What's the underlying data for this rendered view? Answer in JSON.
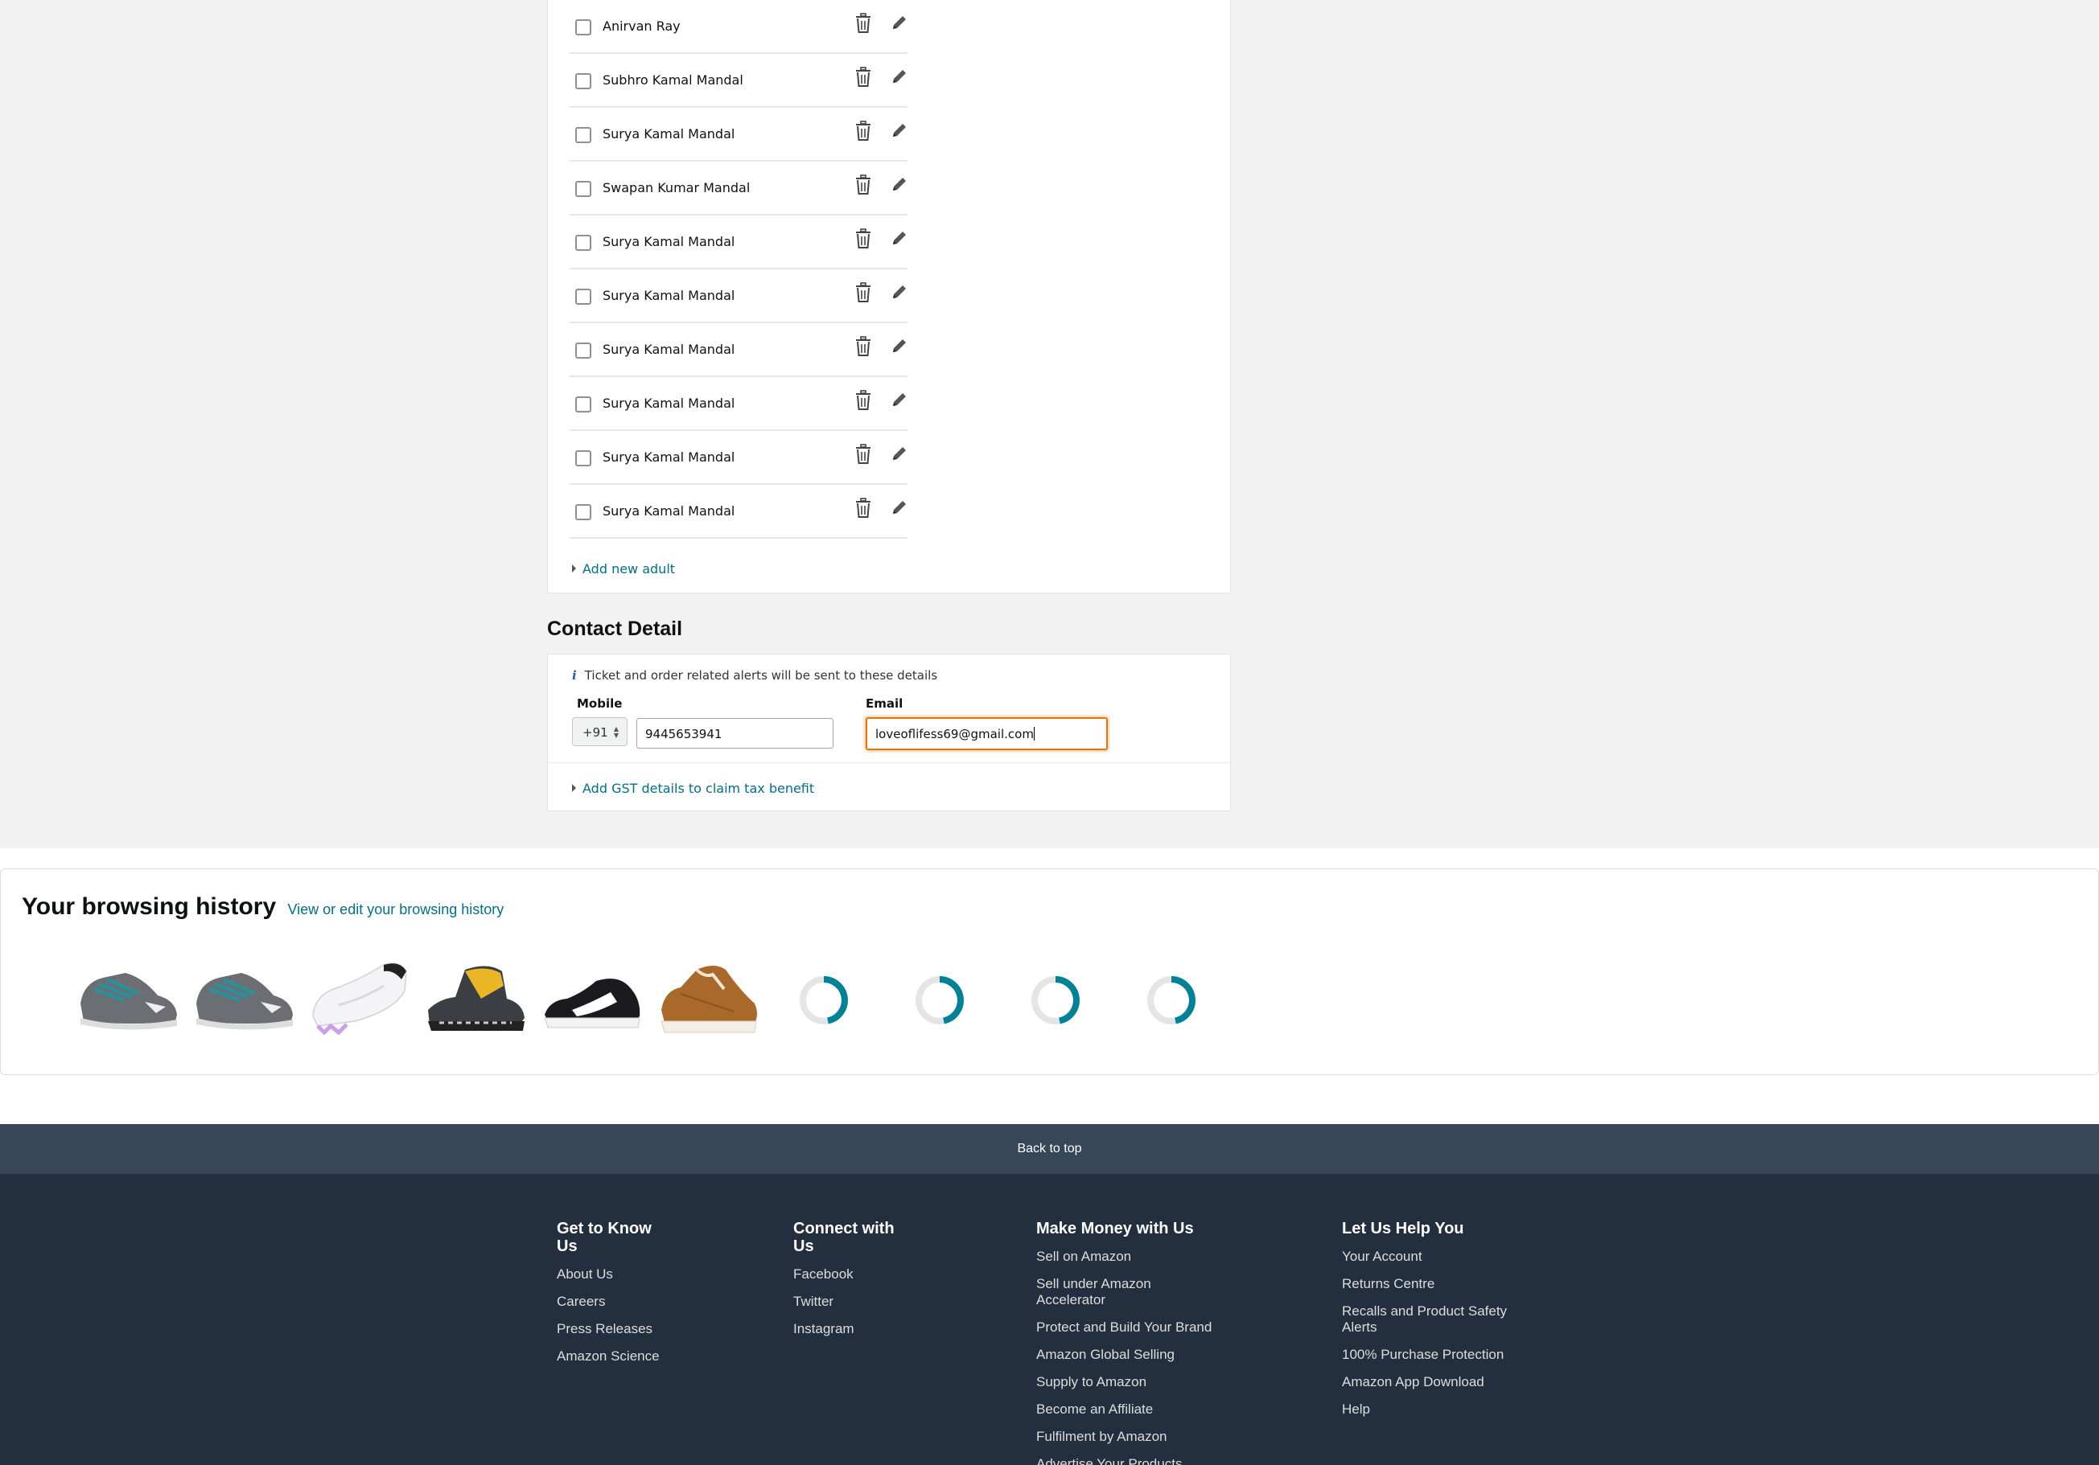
{
  "travellers": {
    "names": [
      "Anirvan Ray",
      "Subhro Kamal Mandal",
      "Surya Kamal Mandal",
      "Swapan Kumar Mandal",
      "Surya Kamal Mandal",
      "Surya Kamal Mandal",
      "Surya Kamal Mandal",
      "Surya Kamal Mandal",
      "Surya Kamal Mandal",
      "Surya Kamal Mandal"
    ],
    "add_label": "Add new adult"
  },
  "contact": {
    "title": "Contact Detail",
    "info": "Ticket and order related alerts will be sent to these details",
    "info_icon": "i",
    "mobile_label": "Mobile",
    "email_label": "Email",
    "country_code": "+91",
    "mobile_value": "9445653941",
    "email_value": "loveoflifess69@gmail.com",
    "gst_label": "Add GST details to claim tax benefit"
  },
  "history": {
    "title": "Your browsing history",
    "link": "View or edit your browsing history",
    "items": [
      {
        "icon": "grey-teal-sport-shoe"
      },
      {
        "icon": "grey-teal-sport-shoe"
      },
      {
        "icon": "white-football-boot"
      },
      {
        "icon": "grey-yellow-hiking-shoe"
      },
      {
        "icon": "black-white-sneaker"
      },
      {
        "icon": "brown-suede-sneaker"
      },
      {
        "icon": "loading-spinner"
      },
      {
        "icon": "loading-spinner"
      },
      {
        "icon": "loading-spinner"
      },
      {
        "icon": "loading-spinner"
      }
    ]
  },
  "footer": {
    "back_to_top": "Back to top",
    "columns": [
      {
        "heading": "Get to Know Us",
        "links": [
          "About Us",
          "Careers",
          "Press Releases",
          "Amazon Science"
        ]
      },
      {
        "heading": "Connect with Us",
        "links": [
          "Facebook",
          "Twitter",
          "Instagram"
        ]
      },
      {
        "heading": "Make Money with Us",
        "links": [
          "Sell on Amazon",
          "Sell under Amazon Accelerator",
          "Protect and Build Your Brand",
          "Amazon Global Selling",
          "Supply to Amazon",
          "Become an Affiliate",
          "Fulfilment by Amazon",
          "Advertise Your Products"
        ]
      },
      {
        "heading": "Let Us Help You",
        "links": [
          "Your Account",
          "Returns Centre",
          "Recalls and Product Safety Alerts",
          "100% Purchase Protection",
          "Amazon App Download",
          "Help"
        ]
      }
    ]
  },
  "colors": {
    "link": "#007185",
    "focus": "#e77600",
    "back_to_top_bg": "#37475a",
    "footer_bg": "#232f3e",
    "spinner": "#008296"
  }
}
